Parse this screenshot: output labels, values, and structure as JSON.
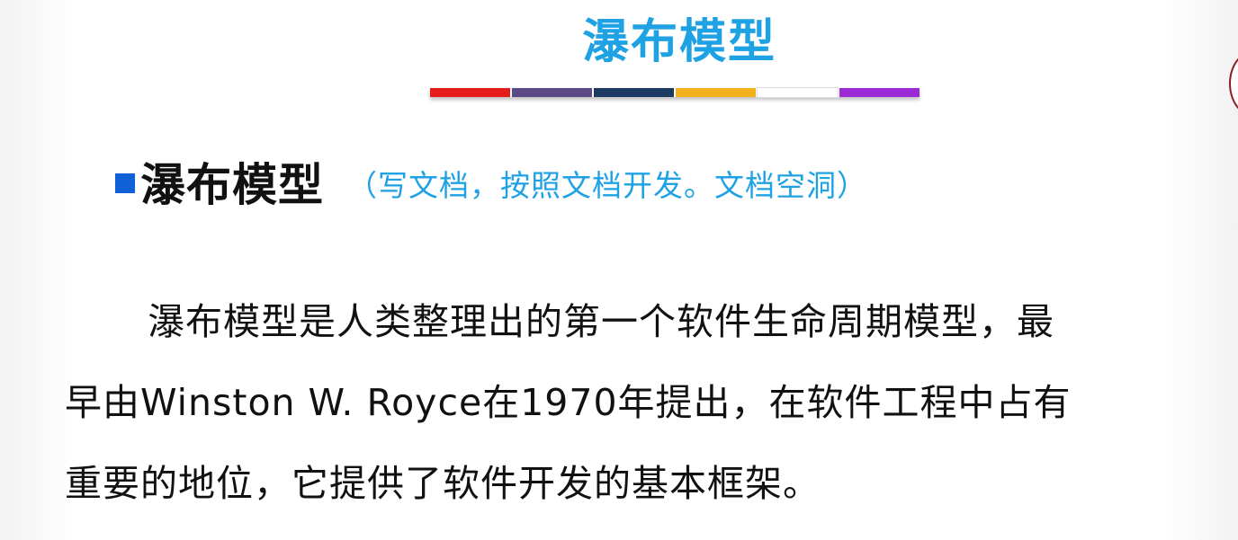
{
  "slide": {
    "title": "瀑布模型",
    "color_bar": [
      "#e51c1c",
      "#5b4a86",
      "#1d3a63",
      "#f2b21c",
      "#ffffff",
      "#9a2bd6"
    ],
    "heading": "瀑布模型",
    "note": "（写文档，按照文档开发。文档空洞）",
    "paragraph_lines": [
      "瀑布模型是人类整理出的第一个软件生命周期模型，最",
      "早由Winston W. Royce在1970年提出，在软件工程中占有",
      "重要的地位，它提供了软件开发的基本框架。"
    ],
    "colors": {
      "title": "#1fa2e4",
      "bullet": "#1060d8",
      "note": "#1fa2e4",
      "text": "#111111"
    }
  }
}
